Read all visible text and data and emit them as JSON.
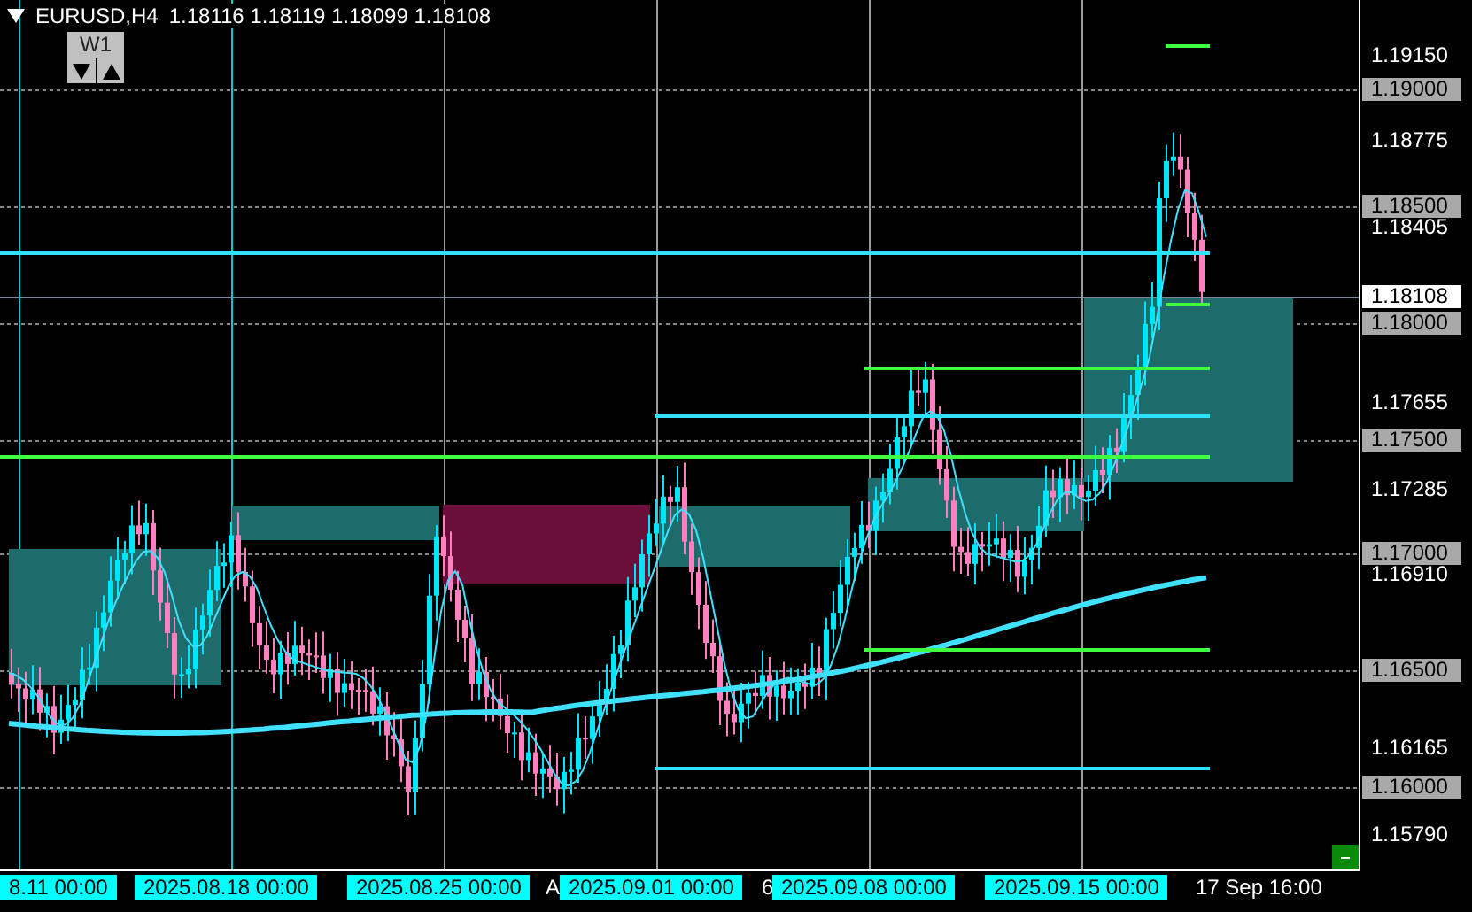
{
  "header": {
    "symbol": "EURUSD,H4",
    "quotes": "1.18116 1.18119 1.18099 1.18108"
  },
  "period_button": {
    "label": "W1"
  },
  "price_axis": [
    {
      "label": "1.19150",
      "kind": "tick"
    },
    {
      "label": "1.19000",
      "kind": "grid"
    },
    {
      "label": "1.18775",
      "kind": "tick"
    },
    {
      "label": "1.18500",
      "kind": "grid"
    },
    {
      "label": "1.18405",
      "kind": "tick"
    },
    {
      "label": "1.18108",
      "kind": "current"
    },
    {
      "label": "1.18000",
      "kind": "grid"
    },
    {
      "label": "1.17655",
      "kind": "tick"
    },
    {
      "label": "1.17500",
      "kind": "grid"
    },
    {
      "label": "1.17285",
      "kind": "tick"
    },
    {
      "label": "1.17000",
      "kind": "grid"
    },
    {
      "label": "1.16910",
      "kind": "tick"
    },
    {
      "label": "1.16500",
      "kind": "grid"
    },
    {
      "label": "1.16165",
      "kind": "tick"
    },
    {
      "label": "1.16000",
      "kind": "grid"
    },
    {
      "label": "1.15790",
      "kind": "tick"
    }
  ],
  "time_axis": [
    {
      "label": "8.11 00:00",
      "kind": "highlight"
    },
    {
      "label": "2025.08.18 00:00",
      "kind": "highlight"
    },
    {
      "label": "2025.08.25 00:00",
      "kind": "highlight"
    },
    {
      "label": "A",
      "kind": "plain"
    },
    {
      "label": "2025.09.01 00:00",
      "kind": "highlight"
    },
    {
      "label": "6",
      "kind": "plain"
    },
    {
      "label": "2025.09.08 00:00",
      "kind": "highlight"
    },
    {
      "label": "2025.09.15 00:00",
      "kind": "highlight"
    },
    {
      "label": "17 Sep 16:00",
      "kind": "plain"
    }
  ]
}
